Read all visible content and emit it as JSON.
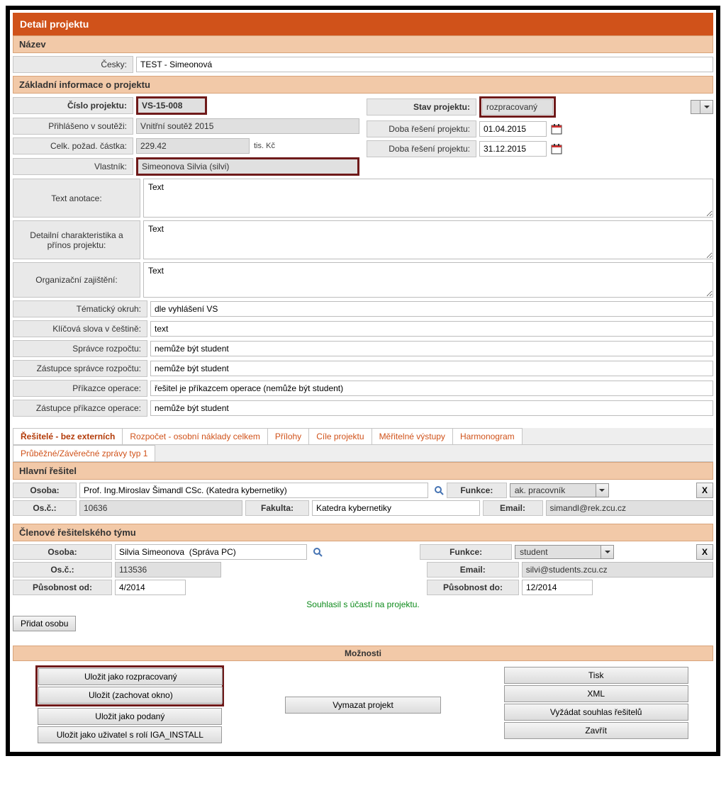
{
  "header": {
    "title": "Detail projektu"
  },
  "name_section": {
    "header": "Název",
    "cesky_label": "Česky:",
    "cesky_value": "TEST - Simeonová"
  },
  "basic_info": {
    "header": "Základní informace o projektu",
    "left": {
      "cislo_label": "Číslo projektu:",
      "cislo_value": "VS-15-008",
      "soutez_label": "Přihlášeno v soutěži:",
      "soutez_value": "Vnitřní soutěž 2015",
      "castka_label": "Celk. požad. částka:",
      "castka_value": "229.42",
      "castka_unit": "tis. Kč",
      "vlastnik_label": "Vlastník:",
      "vlastnik_value": "Simeonova Silvia   (silvi)"
    },
    "right": {
      "stav_label": "Stav projektu:",
      "stav_value": "rozpracovaný",
      "doba1_label": "Doba řešení projektu:",
      "doba1_value": "01.04.2015",
      "doba2_label": "Doba řešení projektu:",
      "doba2_value": "31.12.2015"
    },
    "anotace_label": "Text anotace:",
    "anotace_value": "Text",
    "detail_label": "Detailní charakteristika a přínos projektu:",
    "detail_value": "Text",
    "org_label": "Organizační zajištění:",
    "org_value": "Text",
    "tema_label": "Tématický okruh:",
    "tema_value": "dle vyhlášení VS",
    "klicova_label": "Klíčová slova v češtině:",
    "klicova_value": "text",
    "spravce_label": "Správce rozpočtu:",
    "spravce_value": "nemůže být student",
    "zspravce_label": "Zástupce správce rozpočtu:",
    "zspravce_value": "nemůže být student",
    "prikazce_label": "Příkazce operace:",
    "prikazce_value": "řešitel je příkazcem operace (nemůže být student)",
    "zprikazce_label": "Zástupce příkazce operace:",
    "zprikazce_value": "nemůže být student"
  },
  "tabs": {
    "t1": "Řešitelé - bez externích",
    "t2": "Rozpočet - osobní náklady celkem",
    "t3": "Přílohy",
    "t4": "Cíle projektu",
    "t5": "Měřitelné výstupy",
    "t6": "Harmonogram",
    "t7": "Průběžné/Závěrečné zprávy typ 1"
  },
  "hlavni": {
    "header": "Hlavní řešitel",
    "osoba_label": "Osoba:",
    "osoba_value": "Prof. Ing.Miroslav Šimandl CSc. (Katedra kybernetiky)",
    "osc_label": "Os.č.:",
    "osc_value": "10636",
    "fakulta_label": "Fakulta:",
    "fakulta_value": "Katedra kybernetiky",
    "funkce_label": "Funkce:",
    "funkce_value": "ak. pracovník",
    "email_label": "Email:",
    "email_value": "simandl@rek.zcu.cz",
    "x": "X"
  },
  "clenove": {
    "header": "Členové řešitelského týmu",
    "osoba_label": "Osoba:",
    "osoba_value": "Silvia Simeonova  (Správa PC)",
    "osc_label": "Os.č.:",
    "osc_value": "113536",
    "funkce_label": "Funkce:",
    "funkce_value": "student",
    "email_label": "Email:",
    "email_value": "silvi@students.zcu.cz",
    "od_label": "Působnost od:",
    "od_value": "4/2014",
    "do_label": "Působnost do:",
    "do_value": "12/2014",
    "x": "X",
    "consent": "Souhlasil s účastí na projektu.",
    "add": "Přidat osobu"
  },
  "options": {
    "header": "Možnosti",
    "col1": {
      "b1": "Uložit jako rozpracovaný",
      "b2": "Uložit (zachovat okno)",
      "b3": "Uložit jako podaný",
      "b4": "Uložit jako uživatel s rolí IGA_INSTALL"
    },
    "col2": {
      "b1": "Vymazat projekt"
    },
    "col3": {
      "b1": "Tisk",
      "b2": "XML",
      "b3": "Vyžádat souhlas řešitelů",
      "b4": "Zavřít"
    }
  }
}
